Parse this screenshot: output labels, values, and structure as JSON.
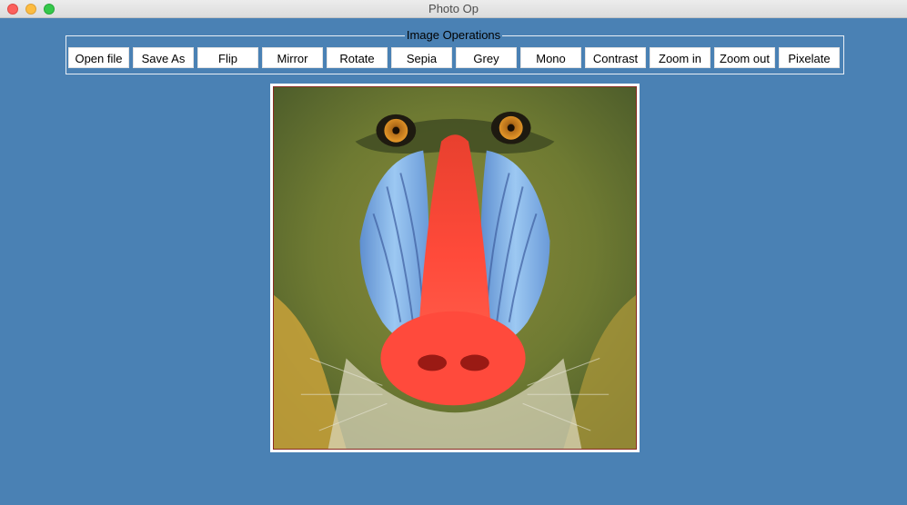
{
  "window": {
    "title": "Photo Op"
  },
  "operations": {
    "legend": "Image Operations",
    "buttons": [
      {
        "label": "Open file"
      },
      {
        "label": "Save As"
      },
      {
        "label": "Flip"
      },
      {
        "label": "Mirror"
      },
      {
        "label": "Rotate"
      },
      {
        "label": "Sepia"
      },
      {
        "label": "Grey"
      },
      {
        "label": "Mono"
      },
      {
        "label": "Contrast"
      },
      {
        "label": "Zoom in"
      },
      {
        "label": "Zoom out"
      },
      {
        "label": "Pixelate"
      }
    ]
  },
  "image": {
    "subject": "mandrill-face-photo"
  },
  "colors": {
    "background": "#4a81b4",
    "button": "#ffffff"
  }
}
